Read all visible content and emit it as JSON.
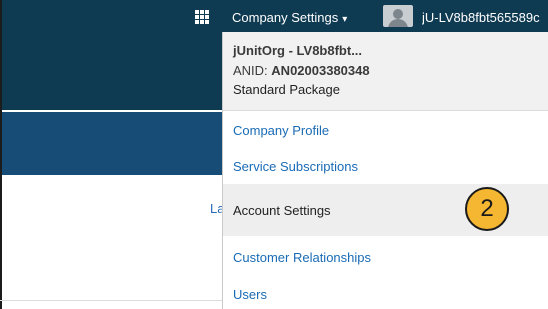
{
  "header": {
    "company_settings_label": "Company Settings",
    "caret": "▾",
    "username": "jU-LV8b8fbt565589c"
  },
  "left_panel": {
    "partial_link": "La"
  },
  "org_info": {
    "name": "jUnitOrg - LV8b8fbt...",
    "anid_label": "ANID:",
    "anid_value": "AN02003380348",
    "package": "Standard Package"
  },
  "menu": {
    "items": [
      {
        "label": "Company Profile"
      },
      {
        "label": "Service Subscriptions"
      },
      {
        "label": "Account Settings"
      },
      {
        "label": "Customer Relationships"
      },
      {
        "label": "Users"
      }
    ]
  },
  "callout": {
    "number": "2",
    "color": "#f5b731"
  },
  "colors": {
    "topbar": "#0e3a52",
    "band": "#164c76",
    "link": "#1a6bb5"
  }
}
